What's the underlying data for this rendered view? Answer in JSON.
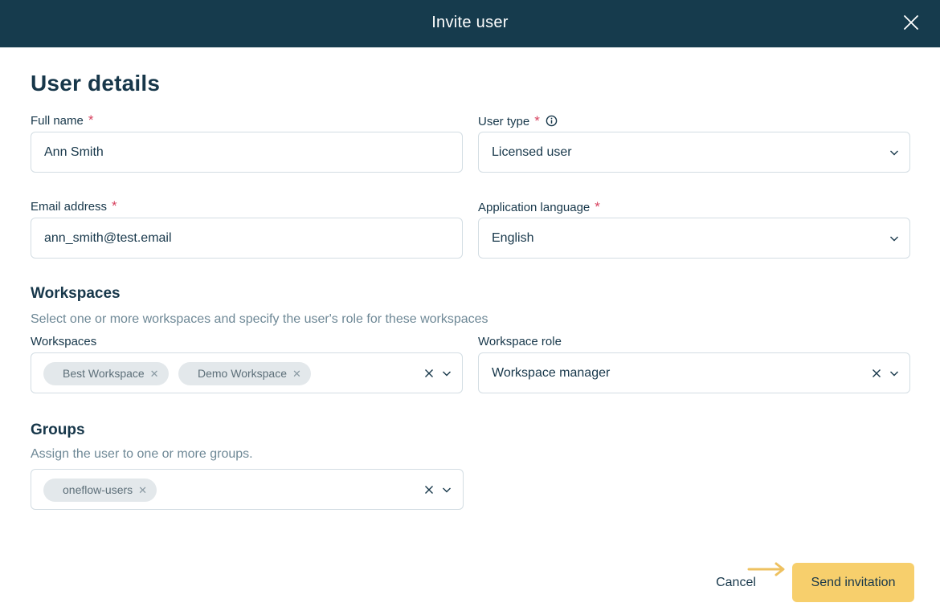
{
  "dialog": {
    "title": "Invite user"
  },
  "user_details": {
    "title": "User details",
    "full_name": {
      "label": "Full name",
      "required_mark": "*",
      "value": "Ann Smith"
    },
    "user_type": {
      "label": "User type",
      "required_mark": "*",
      "value": "Licensed user",
      "info_icon": "info-icon"
    },
    "email": {
      "label": "Email address",
      "required_mark": "*",
      "value": "ann_smith@test.email"
    },
    "language": {
      "label": "Application language",
      "required_mark": "*",
      "value": "English"
    }
  },
  "workspaces": {
    "title": "Workspaces",
    "description": "Select one or more workspaces and specify the user's role for these workspaces",
    "field_label": "Workspaces",
    "chips": [
      "Best Workspace",
      "Demo Workspace"
    ],
    "role_label": "Workspace role",
    "role_value": "Workspace manager"
  },
  "groups": {
    "title": "Groups",
    "description": "Assign the user to one or more groups.",
    "chips": [
      "oneflow-users"
    ]
  },
  "footer": {
    "cancel_label": "Cancel",
    "send_label": "Send invitation",
    "arrow_icon": "arrow-right-icon"
  },
  "colors": {
    "header_bg": "#163b4d",
    "accent_button": "#f7cf6c",
    "required": "#d7425f",
    "arrow": "#eec160"
  }
}
